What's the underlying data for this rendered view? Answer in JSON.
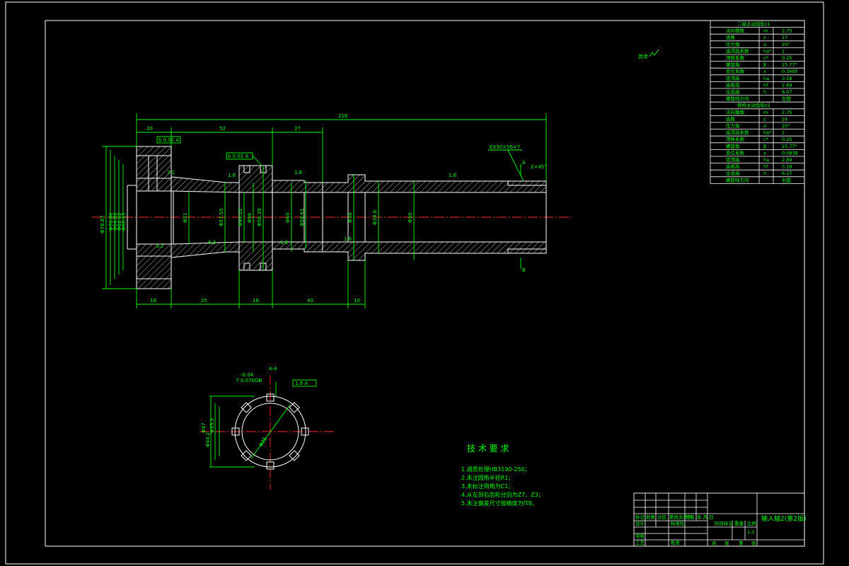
{
  "overall_dimension": "216",
  "top_dimensions": [
    "20",
    "52",
    "27"
  ],
  "bottom_dimensions": [
    "18",
    "25",
    "18",
    "40",
    "10"
  ],
  "left_diameters": [
    "Φ78.87",
    "Φ70.86",
    "Φ64.86",
    "Φ62.02",
    "Φ60.55"
  ],
  "inner_diameters": [
    "Φ51",
    "Φ57.55",
    "Φ44.02",
    "Φ56",
    "Φ56.39",
    "Φ60",
    "Φ58.61",
    "Φ38",
    "Φ34.8",
    "Φ30"
  ],
  "roughness_marks": [
    "3.2",
    "1.6",
    "1.6",
    "1.6",
    "3.2",
    "6.3",
    "1.6",
    "1.6"
  ],
  "tolerance_frames": [
    "b 0.02 A",
    "b 0.02 A",
    "1.6 A"
  ],
  "section_labels": [
    "A",
    "B"
  ],
  "spline_notes": [
    "EX30×56×7",
    "2×45°"
  ],
  "misc_note": "其余",
  "section_view": {
    "label": "A-A",
    "dims": [
      "-0.04",
      "7-0.070GB",
      "Φ47",
      "Φ44.2",
      "Φ35.3",
      "Φ25"
    ],
    "frame": "1.6 A"
  },
  "spec_table": {
    "title": "二级主动齿轮z1",
    "rows": [
      [
        "法向模数",
        "m",
        "2.75"
      ],
      [
        "齿数",
        "z",
        "17"
      ],
      [
        "压力角",
        "α",
        "20°"
      ],
      [
        "齿顶高系数",
        "ha*",
        "1"
      ],
      [
        "顶隙系数",
        "c*",
        "0.25"
      ],
      [
        "螺旋角",
        "β",
        "25.77°"
      ],
      [
        "变位系数",
        "x",
        "0.3495"
      ],
      [
        "齿顶高",
        "ha",
        "3.18"
      ],
      [
        "齿根高",
        "hf",
        "2.89"
      ],
      [
        "全齿高",
        "h",
        "6.07"
      ],
      [
        "螺旋线方向",
        "",
        "左旋"
      ]
    ],
    "title2": "倒档主动齿轮z2",
    "rows2": [
      [
        "法向模数",
        "m",
        "2.75"
      ],
      [
        "齿数",
        "z",
        "24"
      ],
      [
        "压力角",
        "α",
        "20°"
      ],
      [
        "齿顶高系数",
        "ha*",
        "1"
      ],
      [
        "顶隙系数",
        "c*",
        "0.25"
      ],
      [
        "螺旋角",
        "β",
        "25.77°"
      ],
      [
        "变位系数",
        "x",
        "0.0838"
      ],
      [
        "齿顶高",
        "ha",
        "2.89"
      ],
      [
        "齿根高",
        "hf",
        "3.18"
      ],
      [
        "全齿高",
        "h",
        "6.17"
      ],
      [
        "螺旋线方向",
        "",
        "右旋"
      ]
    ]
  },
  "technical_requirements": {
    "title": "技 术 要 求",
    "items": [
      "1.调质处理HB3190-250；",
      "2.未注圆角半径R1；",
      "3.未标注倒角为C1；",
      "4.从左到右齿轮分别为Z7、Z3；",
      "5.未注偏差尺寸按精度为IT8。"
    ]
  },
  "title_block": {
    "drawing_name": "输入轴2(第2版)",
    "labels": [
      "标记",
      "处数",
      "分区",
      "更改文件号",
      "签名",
      "年.月.日",
      "设计",
      "标准化",
      "阶段标记",
      "重量",
      "比例",
      "审核",
      "工艺",
      "批准",
      "共",
      "张",
      "第",
      "张"
    ],
    "scale": "1:1"
  }
}
